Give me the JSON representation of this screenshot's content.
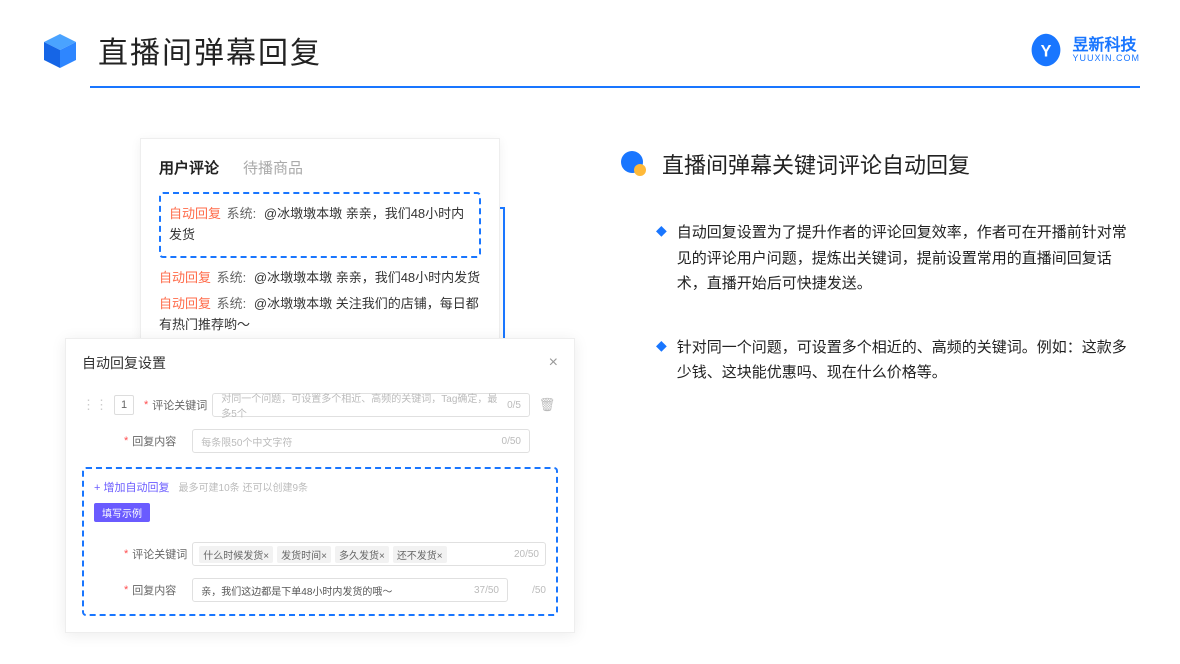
{
  "header": {
    "title": "直播间弹幕回复",
    "logo_main": "昱新科技",
    "logo_sub": "YUUXIN.COM"
  },
  "right": {
    "section_title": "直播间弹幕关键词评论自动回复",
    "bullets": [
      "自动回复设置为了提升作者的评论回复效率，作者可在开播前针对常见的评论用户问题，提炼出关键词，提前设置常用的直播间回复话术，直播开始后可快捷发送。",
      "针对同一个问题，可设置多个相近的、高频的关键词。例如：这款多少钱、这块能优惠吗、现在什么价格等。"
    ]
  },
  "cardTop": {
    "tab_active": "用户评论",
    "tab_inactive": "待播商品",
    "auto_badge": "自动回复",
    "sys_badge": "系统:",
    "line1": "@冰墩墩本墩 亲亲，我们48小时内发货",
    "line2": "@冰墩墩本墩 亲亲，我们48小时内发货",
    "line3": "@冰墩墩本墩 关注我们的店铺，每日都有热门推荐哟～"
  },
  "cardBottom": {
    "title": "自动回复设置",
    "idx": "1",
    "label_keyword": "评论关键词",
    "label_content": "回复内容",
    "placeholder_keyword": "对同一个问题，可设置多个相近、高频的关键词，Tag确定，最多5个",
    "placeholder_content": "每条限50个中文字符",
    "counter_kw": "0/5",
    "counter_ct": "0/50",
    "add_link": "+ 增加自动回复",
    "add_hint": "最多可建10条 还可以创建9条",
    "example_badge": "填写示例",
    "example_tags": [
      "什么时候发货×",
      "发货时间×",
      "多久发货×",
      "还不发货×"
    ],
    "example_kw_counter": "20/50",
    "example_content": "亲，我们这边都是下单48小时内发货的哦～",
    "example_ct_counter": "37/50",
    "outer_counter": "/50"
  }
}
